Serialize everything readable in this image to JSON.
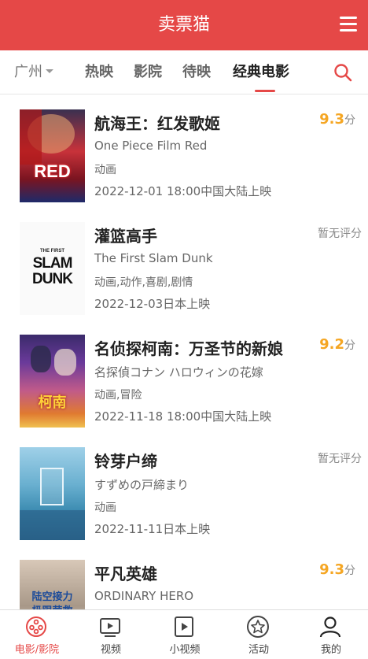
{
  "header": {
    "title": "卖票猫",
    "menu_icon": "menu-icon"
  },
  "nav": {
    "city": "广州",
    "tabs": [
      {
        "label": "热映",
        "active": false
      },
      {
        "label": "影院",
        "active": false
      },
      {
        "label": "待映",
        "active": false
      },
      {
        "label": "经典电影",
        "active": true
      }
    ],
    "search_icon": "search-icon"
  },
  "movies": [
    {
      "title": "航海王：红发歌姬",
      "alt_title": "One Piece Film Red",
      "genre": "动画",
      "release": "2022-12-01 18:00中国大陆上映",
      "score": "9.3",
      "score_unit": "分",
      "poster_text": "RED"
    },
    {
      "title": "灌篮高手",
      "alt_title": "The First Slam Dunk",
      "genre": "动画,动作,喜剧,剧情",
      "release": "2022-12-03日本上映",
      "no_score": "暂无评分",
      "poster_text_top": "THE FIRST",
      "poster_text_mid": "SLAM",
      "poster_text_bot": "DUNK"
    },
    {
      "title": "名侦探柯南：万圣节的新娘",
      "alt_title": "名探偵コナン ハロウィンの花嫁",
      "genre": "动画,冒险",
      "release": "2022-11-18 18:00中国大陆上映",
      "score": "9.2",
      "score_unit": "分",
      "poster_text": "柯南"
    },
    {
      "title": "铃芽户缔",
      "alt_title": "すずめの戸締まり",
      "genre": "动画",
      "release": "2022-11-11日本上映",
      "no_score": "暂无评分"
    },
    {
      "title": "平凡英雄",
      "alt_title": "ORDINARY HERO",
      "score": "9.3",
      "score_unit": "分",
      "poster_text_top": "陆空接力",
      "poster_text_bot": "极限营救"
    }
  ],
  "tabbar": [
    {
      "label": "电影/影院",
      "icon": "film-reel-icon",
      "active": true
    },
    {
      "label": "视频",
      "icon": "video-play-icon",
      "active": false
    },
    {
      "label": "小视频",
      "icon": "short-video-icon",
      "active": false
    },
    {
      "label": "活动",
      "icon": "star-icon",
      "active": false
    },
    {
      "label": "我的",
      "icon": "user-icon",
      "active": false
    }
  ],
  "colors": {
    "brand": "#e54847",
    "score": "#f5a623"
  }
}
